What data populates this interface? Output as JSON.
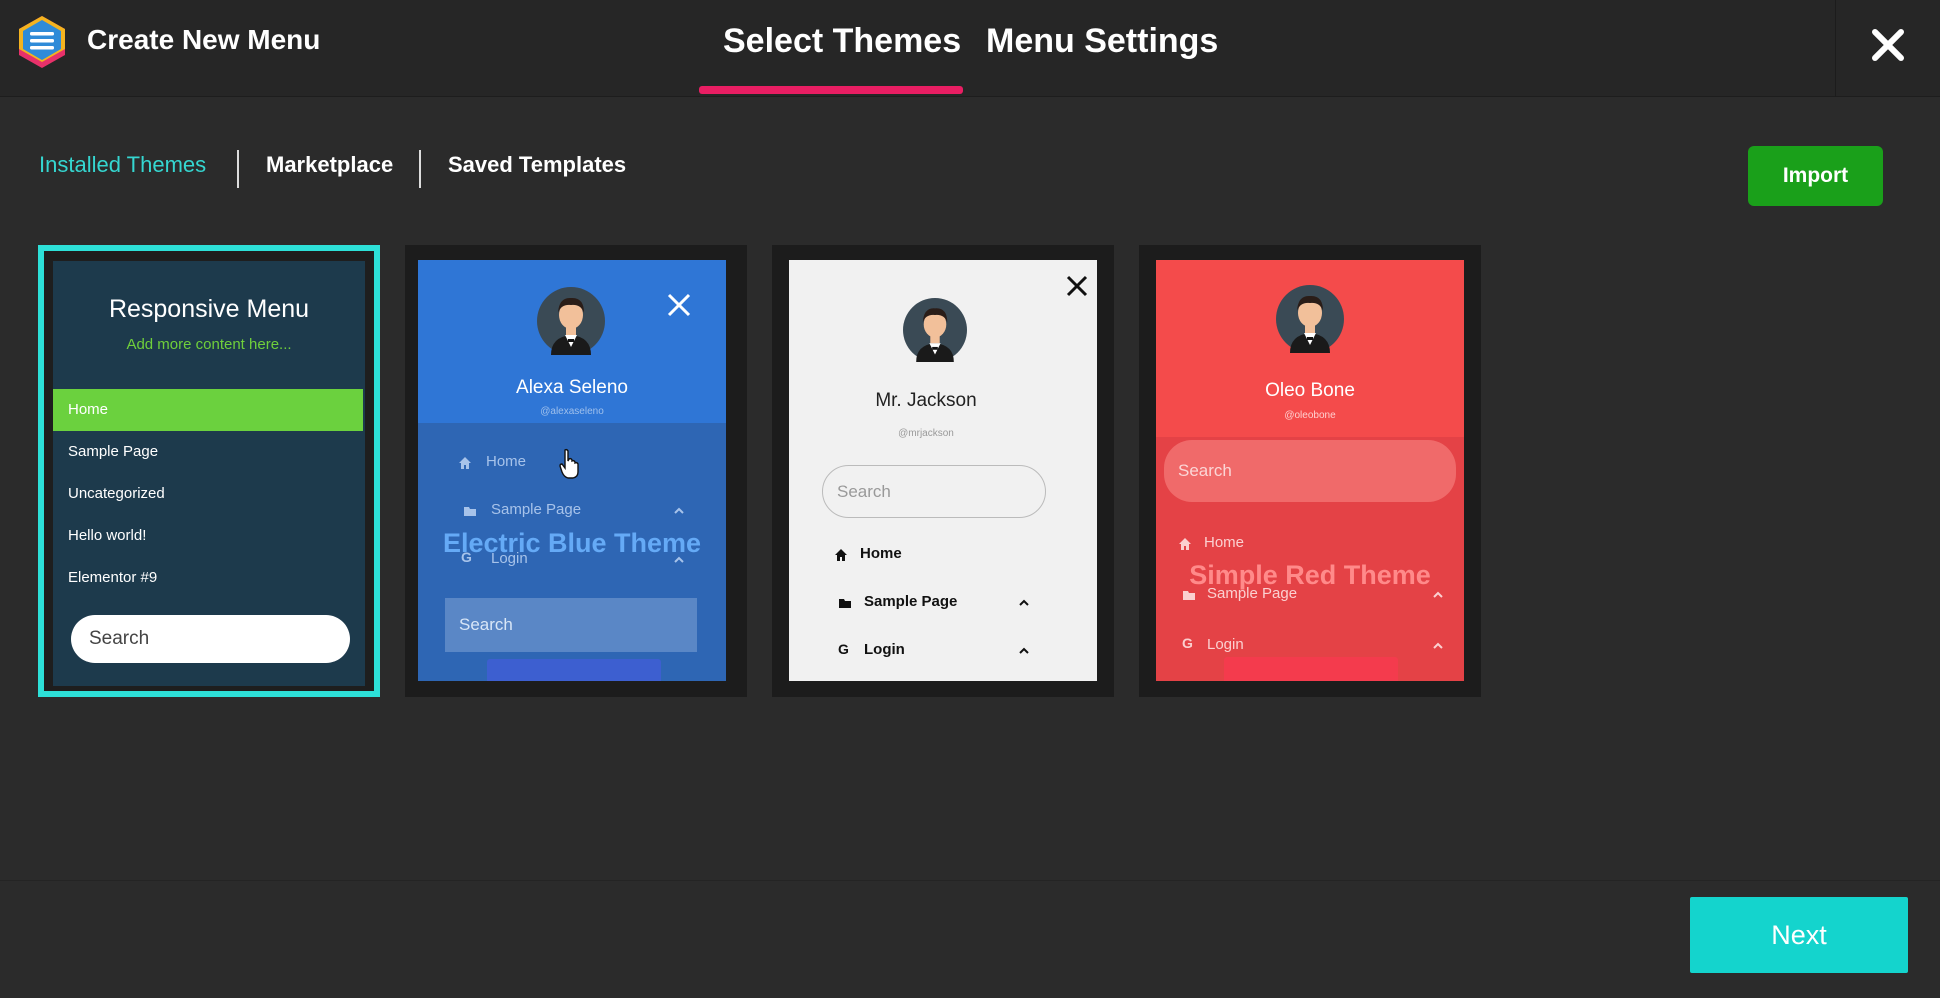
{
  "header": {
    "app_title": "Create New Menu",
    "tabs": [
      {
        "label": "Select Themes",
        "active": true
      },
      {
        "label": "Menu Settings",
        "active": false
      }
    ],
    "close_icon": "close-icon",
    "accent_color": "#e91e63"
  },
  "subnav": {
    "items": [
      {
        "label": "Installed Themes",
        "active": true
      },
      {
        "label": "Marketplace",
        "active": false
      },
      {
        "label": "Saved Templates",
        "active": false
      }
    ],
    "active_color": "#35d6d0",
    "import_label": "Import",
    "import_color": "#1aa01a"
  },
  "themes": [
    {
      "title": "Responsive Menu",
      "subtitle": "Add more content here...",
      "menu_items": [
        "Home",
        "Sample Page",
        "Uncategorized",
        "Hello world!",
        "Elementor #9"
      ],
      "search_placeholder": "Search",
      "selected": true,
      "background": "#1d3a4c",
      "accent": "#6bd13e"
    },
    {
      "name": "Alexa Seleno",
      "handle": "@alexaseleno",
      "menu_items": [
        "Home",
        "Sample Page",
        "Login"
      ],
      "theme_label": "Electric Blue Theme",
      "search_placeholder": "Search",
      "background": "#2f76d6"
    },
    {
      "name": "Mr. Jackson",
      "handle": "@mrjackson",
      "menu_items": [
        "Home",
        "Sample Page",
        "Login"
      ],
      "search_placeholder": "Search",
      "background": "#f1f1f1"
    },
    {
      "name": "Oleo Bone",
      "handle": "@oleobone",
      "menu_items": [
        "Home",
        "Sample Page",
        "Login"
      ],
      "theme_label": "Simple Red Theme",
      "search_placeholder": "Search",
      "background": "#f44b4b"
    }
  ],
  "footer": {
    "next_label": "Next",
    "next_color": "#14d4cd"
  }
}
